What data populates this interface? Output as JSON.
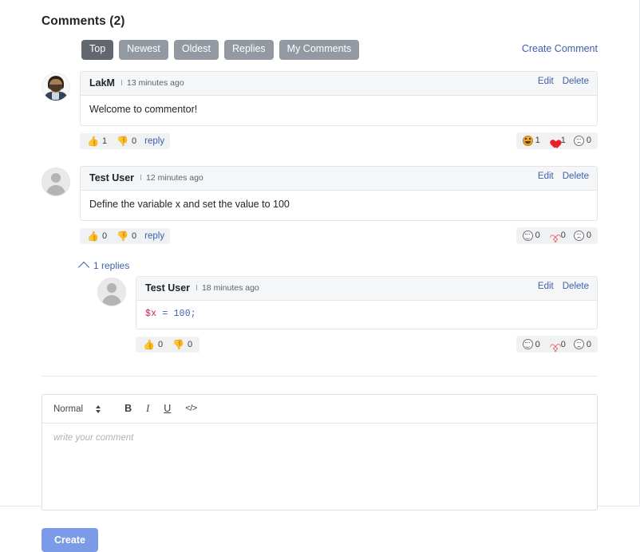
{
  "header": {
    "title": "Comments (2)",
    "create_comment_label": "Create Comment"
  },
  "filters": [
    {
      "label": "Top",
      "active": true
    },
    {
      "label": "Newest",
      "active": false
    },
    {
      "label": "Oldest",
      "active": false
    },
    {
      "label": "Replies",
      "active": false
    },
    {
      "label": "My Comments",
      "active": false
    }
  ],
  "actions": {
    "edit_label": "Edit",
    "delete_label": "Delete",
    "reply_label": "reply",
    "separator": "I"
  },
  "comments": [
    {
      "author": "LakM",
      "timestamp": "13 minutes ago",
      "body": "Welcome to commentor!",
      "avatar": "photo-avatar",
      "upvotes": "1",
      "downvotes": "0",
      "reactions": [
        {
          "icon": "laugh-filled-icon",
          "count": "1"
        },
        {
          "icon": "heart-filled-icon",
          "count": "1"
        },
        {
          "icon": "sad-outline-icon",
          "count": "0"
        }
      ]
    },
    {
      "author": "Test User",
      "timestamp": "12 minutes ago",
      "body": "Define the variable x and set the value to 100",
      "avatar": "generic-avatar",
      "upvotes": "0",
      "downvotes": "0",
      "reactions": [
        {
          "icon": "smile-outline-icon",
          "count": "0"
        },
        {
          "icon": "heart-outline-icon",
          "count": "0"
        },
        {
          "icon": "sad-outline-icon",
          "count": "0"
        }
      ],
      "replies_toggle_label": "1 replies",
      "reply": {
        "author": "Test User",
        "timestamp": "18 minutes ago",
        "code_var": "$x",
        "code_rest": " = 100;",
        "avatar": "generic-avatar",
        "upvotes": "0",
        "downvotes": "0",
        "reactions": [
          {
            "icon": "smile-outline-icon",
            "count": "0"
          },
          {
            "icon": "heart-outline-icon",
            "count": "0"
          },
          {
            "icon": "sad-outline-icon",
            "count": "0"
          }
        ]
      }
    }
  ],
  "editor": {
    "format_label": "Normal",
    "bold_label": "B",
    "italic_label": "I",
    "underline_label": "U",
    "code_label": "</>",
    "placeholder": "write your comment",
    "submit_label": "Create"
  },
  "colors": {
    "link": "#3d5fab",
    "filter_active": "#62676f",
    "filter_inactive": "#9399a3",
    "submit_button": "#7b9ae8",
    "code_text": "#c7254e",
    "heart": "#e8202a"
  }
}
